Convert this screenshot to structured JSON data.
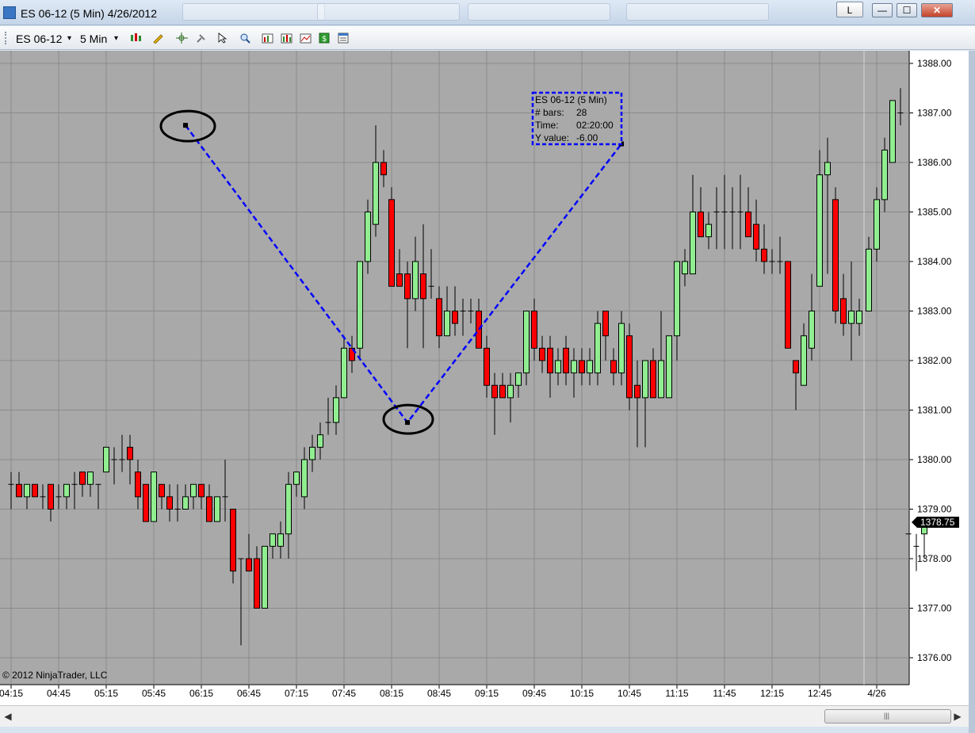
{
  "window": {
    "title": "ES 06-12 (5 Min)  4/26/2012",
    "lock_label": "L",
    "minimize_glyph": "—",
    "maximize_glyph": "☐",
    "close_glyph": "✕"
  },
  "toolbar": {
    "instrument": "ES 06-12",
    "interval": "5 Min",
    "dropdown_glyph": "▾",
    "icons": [
      "candlestick-icon",
      "pencil-icon",
      "crosshair-icon",
      "pin-icon",
      "pointer-icon",
      "zoom-icon",
      "indicators-icon",
      "strategies-icon",
      "chart-style-icon",
      "dollar-icon",
      "properties-icon"
    ]
  },
  "copyright": "© 2012 NinjaTrader, LLC",
  "last_price": "1378.75",
  "scrollbar": {
    "left_arrow": "◀",
    "right_arrow": "▶",
    "grip": "|||"
  },
  "chart_data": {
    "type": "candlestick",
    "instrument": "ES 06-12",
    "interval": "5 Min",
    "date": "4/26/2012",
    "y_ticks": [
      1388,
      1387,
      1386,
      1385,
      1384,
      1383,
      1382,
      1381,
      1380,
      1379,
      1378,
      1377,
      1376
    ],
    "y_tick_labels": [
      "1388.00",
      "1387.00",
      "1386.00",
      "1385.00",
      "1384.00",
      "1383.00",
      "1382.00",
      "1381.00",
      "1380.00",
      "1379.00",
      "1378.00",
      "1377.00",
      "1376.00"
    ],
    "ylim": [
      1375.75,
      1388.25
    ],
    "x_tick_labels": [
      "04:15",
      "04:45",
      "05:15",
      "05:45",
      "06:15",
      "06:45",
      "07:15",
      "07:45",
      "08:15",
      "08:45",
      "09:15",
      "09:45",
      "10:15",
      "10:45",
      "11:15",
      "11:45",
      "12:15",
      "12:45",
      "4/26"
    ],
    "x_tick_bar_index": [
      0,
      6,
      12,
      18,
      24,
      30,
      36,
      42,
      48,
      54,
      60,
      66,
      72,
      78,
      84,
      90,
      96,
      102,
      109
    ],
    "grid": true,
    "up_color": "#90ee90",
    "down_color": "#ff0000",
    "session_break_after_bar": 107,
    "bars": [
      [
        1379.5,
        1379.75,
        1379.0,
        1379.5
      ],
      [
        1379.5,
        1379.75,
        1379.25,
        1379.25
      ],
      [
        1379.25,
        1379.5,
        1379.0,
        1379.5
      ],
      [
        1379.5,
        1379.5,
        1379.25,
        1379.25
      ],
      [
        1379.25,
        1379.5,
        1379.0,
        1379.25
      ],
      [
        1379.5,
        1379.5,
        1378.75,
        1379.0
      ],
      [
        1379.25,
        1379.5,
        1379.0,
        1379.25
      ],
      [
        1379.25,
        1379.5,
        1379.0,
        1379.5
      ],
      [
        1379.5,
        1379.75,
        1379.0,
        1379.5
      ],
      [
        1379.75,
        1379.75,
        1379.25,
        1379.5
      ],
      [
        1379.5,
        1379.75,
        1379.25,
        1379.75
      ],
      [
        1379.5,
        1379.5,
        1379.0,
        1379.5
      ],
      [
        1379.75,
        1380.25,
        1379.75,
        1380.25
      ],
      [
        1380.0,
        1380.25,
        1379.5,
        1380.0
      ],
      [
        1380.0,
        1380.5,
        1379.75,
        1380.0
      ],
      [
        1380.25,
        1380.5,
        1379.5,
        1380.0
      ],
      [
        1379.75,
        1380.0,
        1379.0,
        1379.25
      ],
      [
        1379.5,
        1379.5,
        1378.75,
        1378.75
      ],
      [
        1378.75,
        1379.75,
        1378.75,
        1379.75
      ],
      [
        1379.5,
        1379.5,
        1379.0,
        1379.25
      ],
      [
        1379.25,
        1379.5,
        1378.75,
        1379.0
      ],
      [
        1379.0,
        1379.5,
        1378.75,
        1379.0
      ],
      [
        1379.0,
        1379.5,
        1379.0,
        1379.25
      ],
      [
        1379.25,
        1379.5,
        1379.0,
        1379.5
      ],
      [
        1379.5,
        1379.5,
        1379.0,
        1379.25
      ],
      [
        1379.25,
        1379.5,
        1378.75,
        1378.75
      ],
      [
        1378.75,
        1379.25,
        1378.75,
        1379.25
      ],
      [
        1379.25,
        1380.0,
        1378.75,
        1379.25
      ],
      [
        1379.0,
        1379.0,
        1377.5,
        1377.75
      ],
      [
        1378.0,
        1378.0,
        1376.25,
        1378.0
      ],
      [
        1378.0,
        1378.5,
        1377.75,
        1377.75
      ],
      [
        1378.0,
        1378.25,
        1377.0,
        1377.0
      ],
      [
        1377.0,
        1378.25,
        1377.0,
        1378.25
      ],
      [
        1378.25,
        1378.5,
        1378.0,
        1378.5
      ],
      [
        1378.25,
        1378.75,
        1378.0,
        1378.5
      ],
      [
        1378.5,
        1379.75,
        1378.0,
        1379.5
      ],
      [
        1379.5,
        1379.75,
        1379.25,
        1379.75
      ],
      [
        1379.25,
        1380.25,
        1379.0,
        1380.0
      ],
      [
        1380.0,
        1380.5,
        1379.75,
        1380.25
      ],
      [
        1380.25,
        1380.75,
        1380.0,
        1380.5
      ],
      [
        1380.75,
        1381.25,
        1380.5,
        1380.75
      ],
      [
        1380.75,
        1381.5,
        1380.5,
        1381.25
      ],
      [
        1381.25,
        1382.5,
        1381.25,
        1382.25
      ],
      [
        1382.25,
        1382.5,
        1381.75,
        1382.0
      ],
      [
        1382.25,
        1383.75,
        1382.0,
        1384.0
      ],
      [
        1384.0,
        1385.25,
        1383.75,
        1385.0
      ],
      [
        1384.75,
        1386.75,
        1384.5,
        1386.0
      ],
      [
        1386.0,
        1386.25,
        1385.5,
        1385.75
      ],
      [
        1385.25,
        1385.5,
        1383.5,
        1383.5
      ],
      [
        1383.75,
        1384.25,
        1383.5,
        1383.5
      ],
      [
        1383.75,
        1384.0,
        1382.25,
        1383.25
      ],
      [
        1383.25,
        1384.5,
        1383.0,
        1384.0
      ],
      [
        1383.75,
        1384.75,
        1382.25,
        1383.25
      ],
      [
        1383.5,
        1384.25,
        1383.25,
        1383.5
      ],
      [
        1383.25,
        1383.5,
        1382.25,
        1382.5
      ],
      [
        1382.5,
        1383.5,
        1382.5,
        1383.0
      ],
      [
        1383.0,
        1383.5,
        1382.5,
        1382.75
      ],
      [
        1383.0,
        1383.25,
        1382.5,
        1383.0
      ],
      [
        1383.0,
        1383.25,
        1382.75,
        1383.0
      ],
      [
        1383.0,
        1383.25,
        1382.25,
        1382.25
      ],
      [
        1382.25,
        1382.5,
        1381.25,
        1381.5
      ],
      [
        1381.5,
        1381.75,
        1380.5,
        1381.25
      ],
      [
        1381.5,
        1381.75,
        1381.25,
        1381.25
      ],
      [
        1381.25,
        1381.75,
        1380.75,
        1381.5
      ],
      [
        1381.5,
        1381.75,
        1381.25,
        1381.75
      ],
      [
        1381.75,
        1383.0,
        1381.5,
        1383.0
      ],
      [
        1383.0,
        1383.25,
        1382.0,
        1382.25
      ],
      [
        1382.25,
        1382.5,
        1381.75,
        1382.0
      ],
      [
        1382.25,
        1382.5,
        1381.25,
        1381.75
      ],
      [
        1381.75,
        1382.25,
        1381.5,
        1382.0
      ],
      [
        1382.25,
        1382.5,
        1381.5,
        1381.75
      ],
      [
        1381.75,
        1382.25,
        1381.25,
        1382.0
      ],
      [
        1382.0,
        1382.25,
        1381.5,
        1381.75
      ],
      [
        1381.75,
        1382.25,
        1381.5,
        1382.0
      ],
      [
        1381.75,
        1383.0,
        1381.5,
        1382.75
      ],
      [
        1383.0,
        1383.0,
        1382.0,
        1382.5
      ],
      [
        1382.0,
        1382.25,
        1381.5,
        1381.75
      ],
      [
        1381.75,
        1383.0,
        1381.5,
        1382.75
      ],
      [
        1382.5,
        1382.75,
        1381.0,
        1381.25
      ],
      [
        1381.5,
        1382.0,
        1380.25,
        1381.25
      ],
      [
        1381.25,
        1382.0,
        1380.25,
        1382.0
      ],
      [
        1382.0,
        1382.25,
        1381.25,
        1381.25
      ],
      [
        1381.25,
        1383.0,
        1381.25,
        1382.0
      ],
      [
        1381.25,
        1382.5,
        1381.25,
        1382.5
      ],
      [
        1382.5,
        1384.0,
        1382.0,
        1384.0
      ],
      [
        1383.75,
        1384.25,
        1383.5,
        1384.0
      ],
      [
        1383.75,
        1385.75,
        1383.75,
        1385.0
      ],
      [
        1385.0,
        1385.5,
        1384.5,
        1384.5
      ],
      [
        1384.5,
        1385.0,
        1384.25,
        1384.75
      ],
      [
        1385.0,
        1385.5,
        1384.25,
        1385.0
      ],
      [
        1385.0,
        1385.75,
        1384.25,
        1385.0
      ],
      [
        1385.0,
        1385.5,
        1384.25,
        1385.0
      ],
      [
        1385.0,
        1385.75,
        1384.25,
        1385.0
      ],
      [
        1385.0,
        1385.5,
        1384.5,
        1384.5
      ],
      [
        1384.75,
        1385.25,
        1384.0,
        1384.25
      ],
      [
        1384.25,
        1384.75,
        1383.75,
        1384.0
      ],
      [
        1384.0,
        1384.25,
        1383.75,
        1384.0
      ],
      [
        1384.0,
        1384.5,
        1383.75,
        1384.0
      ],
      [
        1384.0,
        1384.0,
        1382.25,
        1382.25
      ],
      [
        1382.0,
        1382.0,
        1381.0,
        1381.75
      ],
      [
        1381.5,
        1382.75,
        1381.5,
        1382.5
      ],
      [
        1382.25,
        1383.75,
        1382.0,
        1383.0
      ],
      [
        1383.5,
        1386.25,
        1383.5,
        1385.75
      ],
      [
        1385.75,
        1386.5,
        1383.75,
        1386.0
      ],
      [
        1385.25,
        1385.5,
        1382.75,
        1383.0
      ],
      [
        1383.25,
        1383.75,
        1382.5,
        1382.75
      ],
      [
        1382.75,
        1384.0,
        1382.0,
        1383.0
      ],
      [
        1382.75,
        1383.25,
        1382.5,
        1383.0
      ],
      [
        1383.0,
        1384.5,
        1383.0,
        1384.25
      ],
      [
        1384.25,
        1385.5,
        1384.0,
        1385.25
      ],
      [
        1385.25,
        1386.5,
        1385.0,
        1386.25
      ],
      [
        1386.0,
        1387.25,
        1386.0,
        1387.25
      ],
      [
        1387.0,
        1387.5,
        1386.75,
        1387.0
      ],
      [
        1378.5,
        1378.5,
        1378.5,
        1378.5
      ],
      [
        1378.25,
        1378.5,
        1377.75,
        1378.25
      ],
      [
        1378.5,
        1378.75,
        1378.0,
        1378.75
      ]
    ],
    "annotation": {
      "type": "ruler",
      "vertices": [
        {
          "bar_index": 22,
          "price": 1386.75
        },
        {
          "bar_index": 50,
          "price": 1380.75
        },
        {
          "bar_index": 77,
          "price": 1386.375
        }
      ],
      "color": "#0000ff",
      "info_box": {
        "line1": "ES 06-12 (5 Min)",
        "line2_label": "# bars:",
        "line2_value": "28",
        "line3_label": "Time:",
        "line3_value": "02:20:00",
        "line4_label": "Y value:",
        "line4_value": "-6.00"
      }
    }
  }
}
